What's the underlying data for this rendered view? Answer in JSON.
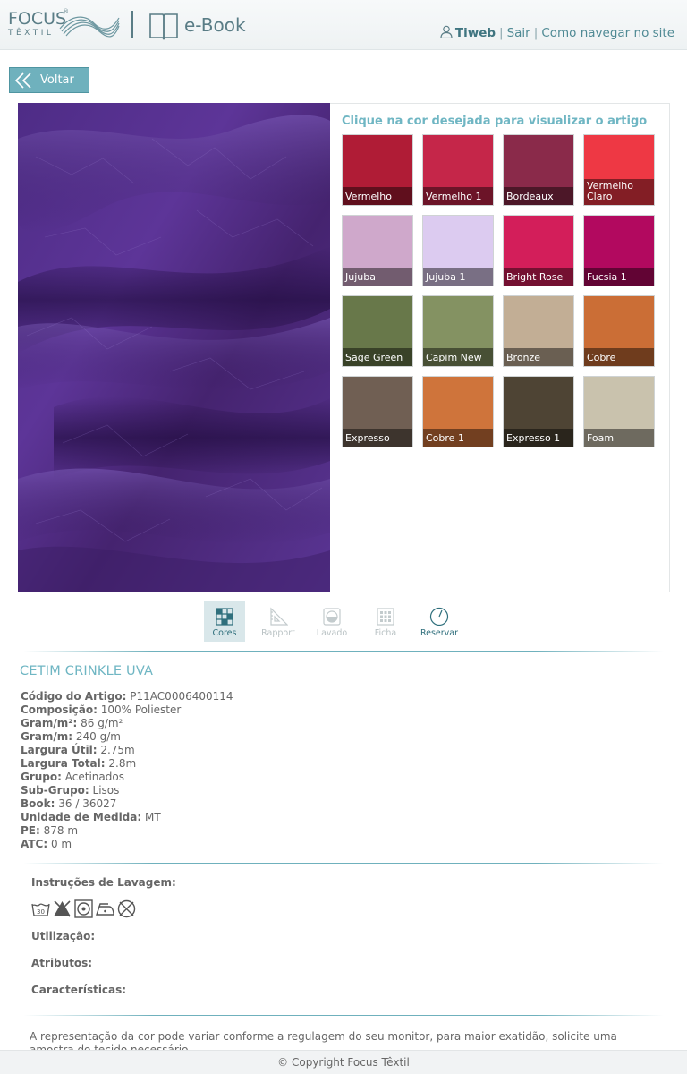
{
  "header": {
    "logo_word": "FOCUS",
    "logo_reg": "®",
    "logo_sub": "TÊXTIL",
    "ebook_label": "e-Book",
    "user_name": "Tiweb",
    "logout_label": "Sair",
    "help_label": "Como navegar no site",
    "separator": "|"
  },
  "back_button": {
    "label": "Voltar"
  },
  "color_panel": {
    "title": "Clique na cor desejada para visualizar o artigo",
    "swatches": [
      {
        "name": "Vermelho",
        "color": "#b01c36"
      },
      {
        "name": "Vermelho 1",
        "color": "#c52649"
      },
      {
        "name": "Bordeaux",
        "color": "#8a2a4a"
      },
      {
        "name": "Vermelho Claro",
        "color": "#ee3844"
      },
      {
        "name": "Jujuba",
        "color": "#cfa8cb"
      },
      {
        "name": "Jujuba 1",
        "color": "#dccbf0"
      },
      {
        "name": "Bright Rose",
        "color": "#d31e5a"
      },
      {
        "name": "Fucsia 1",
        "color": "#b2095f"
      },
      {
        "name": "Sage Green",
        "color": "#68784a"
      },
      {
        "name": "Capim New",
        "color": "#849262"
      },
      {
        "name": "Bronze",
        "color": "#c2ae95"
      },
      {
        "name": "Cobre",
        "color": "#cb6e36"
      },
      {
        "name": "Expresso",
        "color": "#705f53"
      },
      {
        "name": "Cobre 1",
        "color": "#cf743b"
      },
      {
        "name": "Expresso 1",
        "color": "#4e4434"
      },
      {
        "name": "Foam",
        "color": "#c9c2ad"
      }
    ]
  },
  "tabs": [
    {
      "label": "Cores",
      "state": "active"
    },
    {
      "label": "Rapport",
      "state": "disabled"
    },
    {
      "label": "Lavado",
      "state": "disabled"
    },
    {
      "label": "Ficha",
      "state": "disabled"
    },
    {
      "label": "Reservar",
      "state": "enabled"
    }
  ],
  "product": {
    "title": "CETIM CRINKLE UVA",
    "specs": [
      {
        "key": "Código do Artigo:",
        "value": "P11AC0006400114"
      },
      {
        "key": "Composição:",
        "value": "100% Poliester"
      },
      {
        "key": "Gram/m²:",
        "value": "86 g/m²"
      },
      {
        "key": "Gram/m:",
        "value": "240 g/m"
      },
      {
        "key": "Largura Útil:",
        "value": "2.75m"
      },
      {
        "key": "Largura Total:",
        "value": "2.8m"
      },
      {
        "key": "Grupo:",
        "value": "Acetinados"
      },
      {
        "key": "Sub-Grupo:",
        "value": "Lisos"
      },
      {
        "key": "Book:",
        "value": "36 / 36027"
      },
      {
        "key": "Unidade de Medida:",
        "value": "MT"
      },
      {
        "key": "PE:",
        "value": "878 m"
      },
      {
        "key": "ATC:",
        "value": "0 m"
      }
    ]
  },
  "care": {
    "wash_title": "Instruções de Lavagem:",
    "wash_temp": "30",
    "icons": [
      "wash-30-icon",
      "no-bleach-icon",
      "tumble-dry-icon",
      "iron-low-icon",
      "no-dry-clean-icon"
    ],
    "usage_label": "Utilização:",
    "attributes_label": "Atributos:",
    "features_label": "Características:"
  },
  "disclaimer": "A representação da cor pode variar conforme a regulagem do seu monitor, para maior exatidão, solicite uma amostra do tecido necessário.",
  "footer": {
    "copyright": "© Copyright Focus Têxtil"
  },
  "accent_color": "#6fb1bd"
}
